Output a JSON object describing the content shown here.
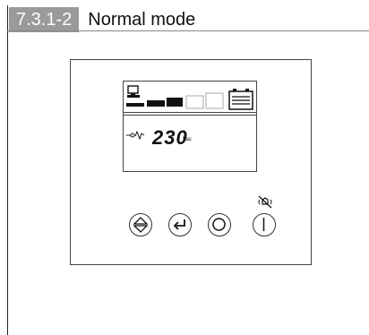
{
  "figure": {
    "number": "7.3.1-2",
    "title": "Normal mode"
  },
  "lcd": {
    "voltage": "230",
    "unit": "Vac",
    "load_bars_filled": 3,
    "load_bars_total": 5
  },
  "buttons": [
    {
      "icon": "scroll-updown-icon"
    },
    {
      "icon": "enter-icon"
    },
    {
      "icon": "off-icon"
    },
    {
      "icon": "on-icon"
    }
  ],
  "alarm_icon": "alarm-muted-icon"
}
